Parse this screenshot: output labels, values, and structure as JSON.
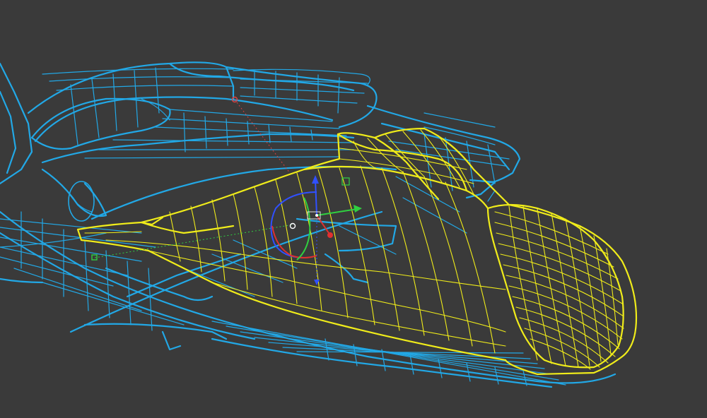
{
  "viewport": {
    "background_color": "#3a3a3a",
    "wireframe_color": "#22a8e6",
    "selected_wireframe_color": "#f0ec1a"
  },
  "gizmo": {
    "x_axis_color": "#e03030",
    "y_axis_color": "#30d040",
    "z_axis_color": "#3050ff",
    "rotate_ring_red": "#e03030",
    "rotate_ring_green": "#30d040",
    "rotate_ring_blue": "#3050ff",
    "pivot_icon": "pivot-circle-icon"
  },
  "markers": {
    "light_point_color": "#e04040",
    "handle_point_color": "#30d040"
  }
}
